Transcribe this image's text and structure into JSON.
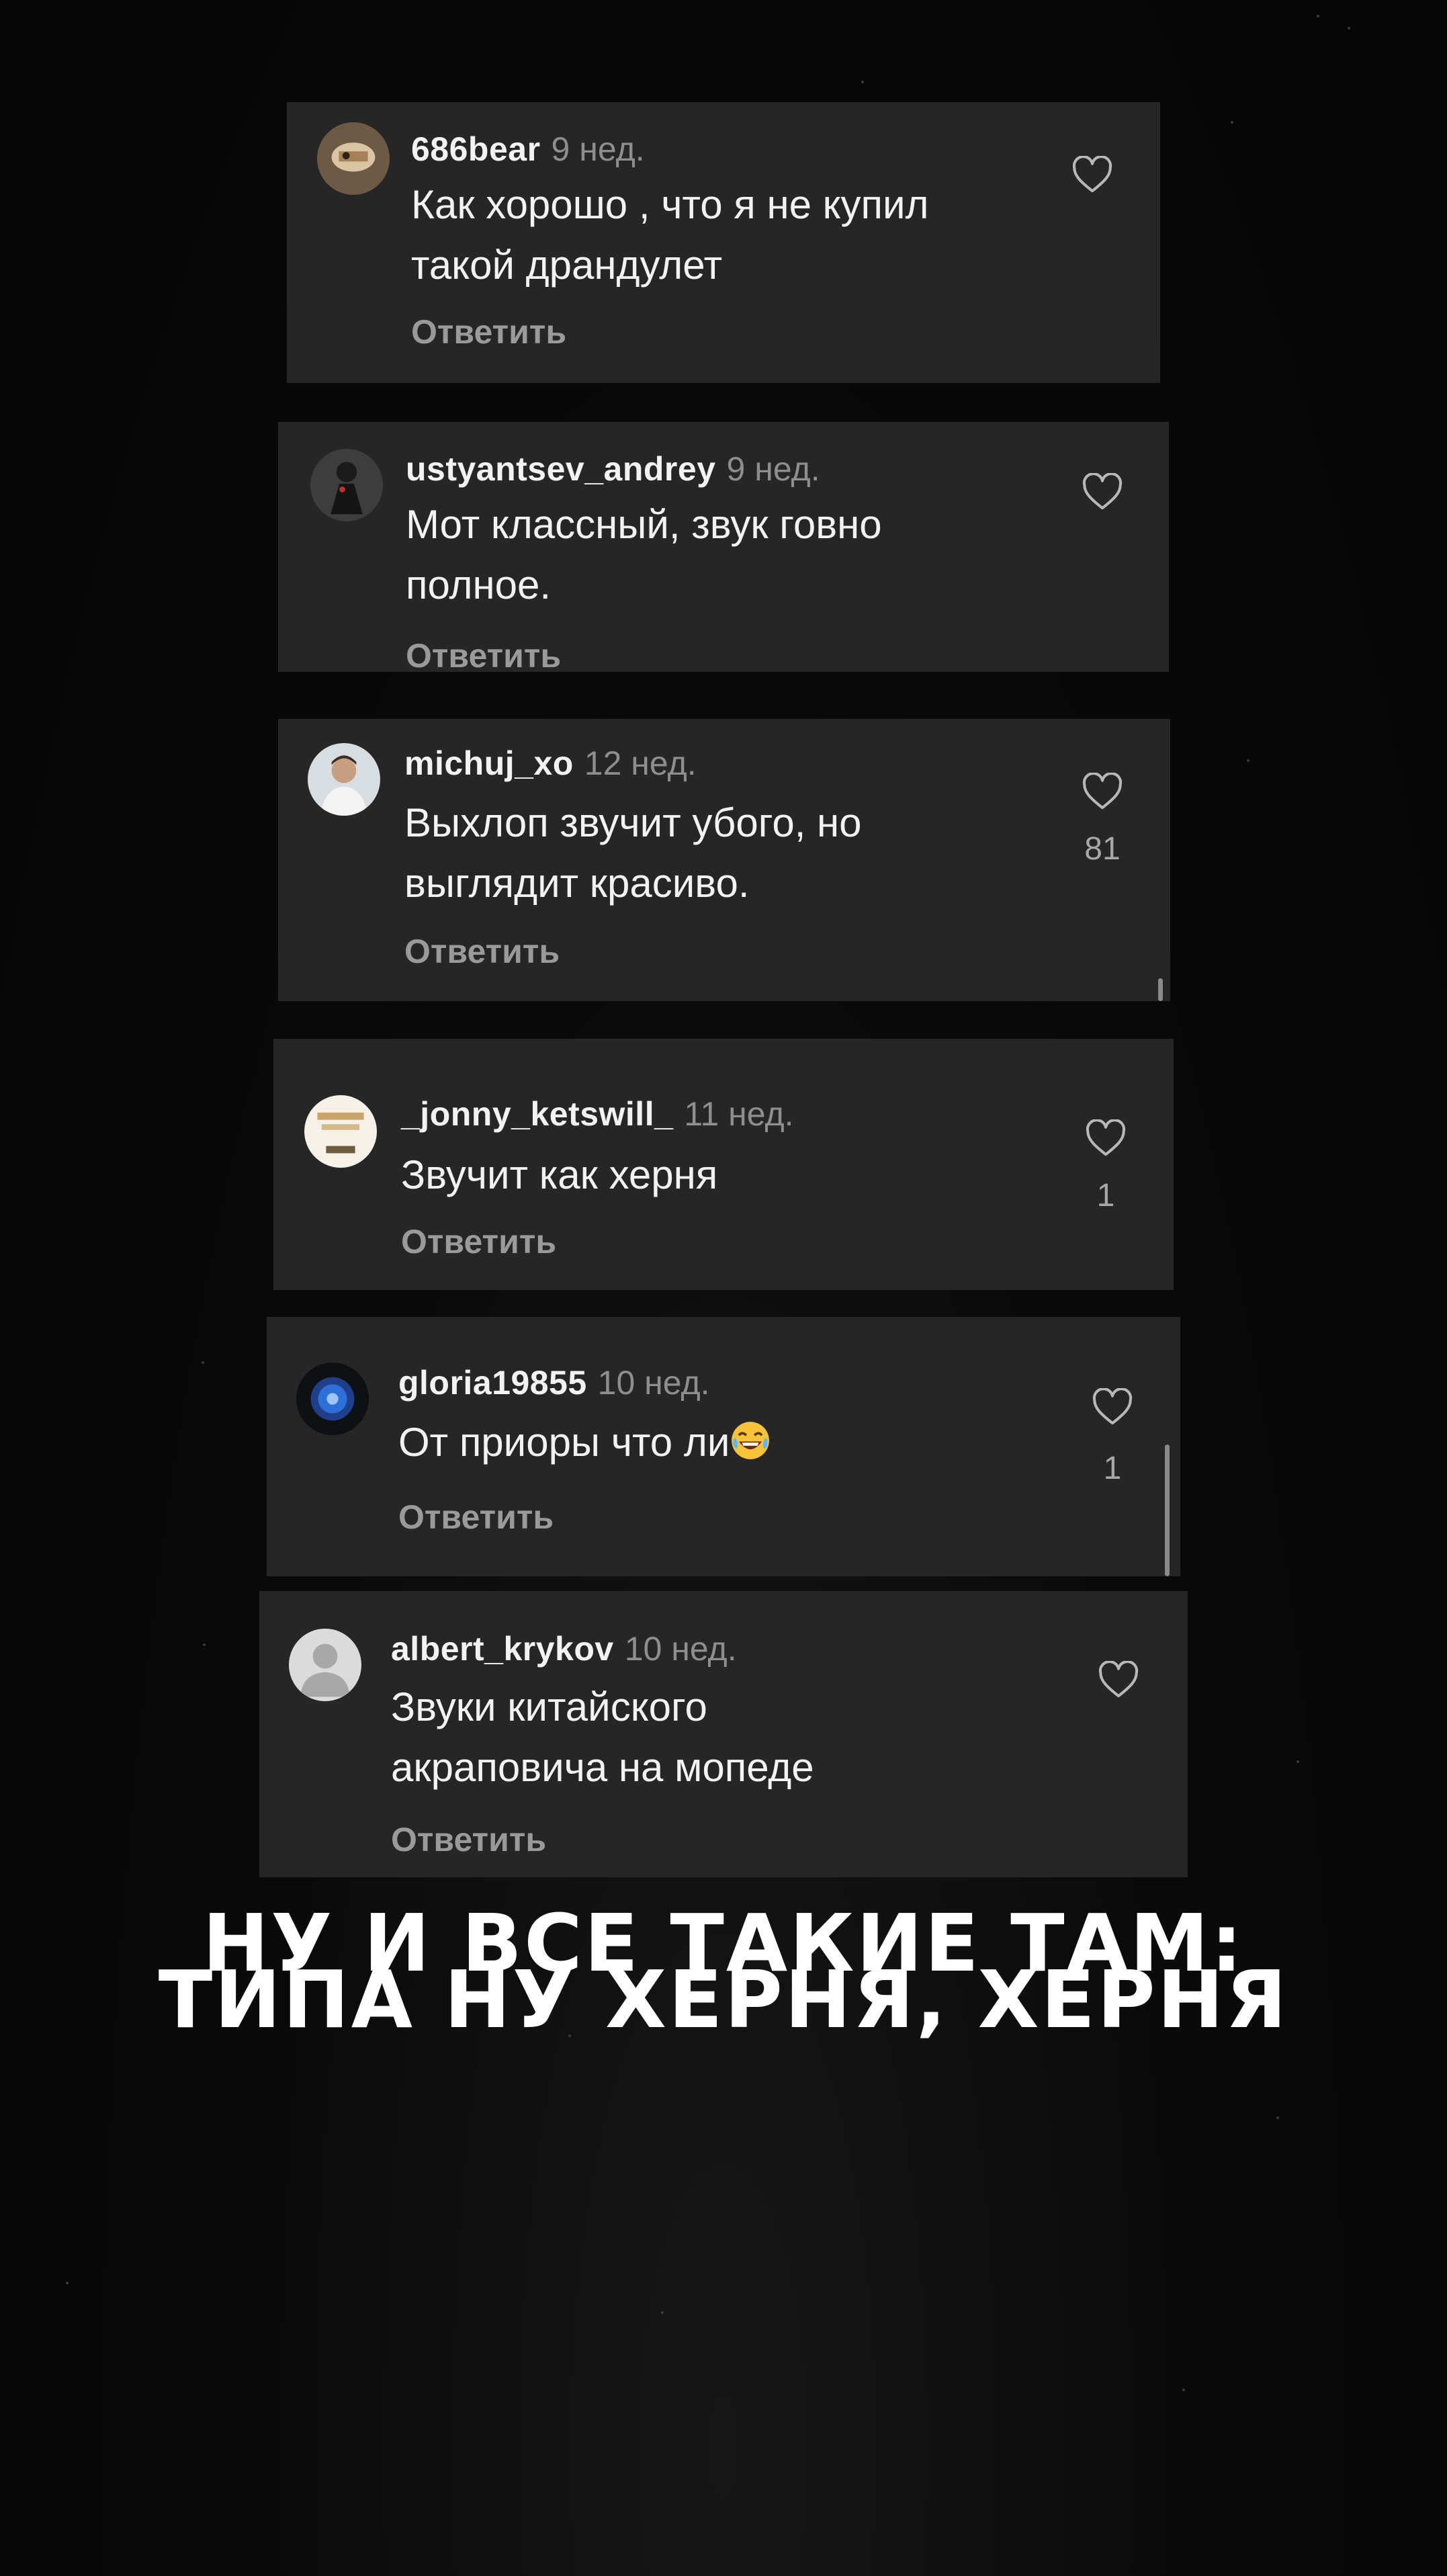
{
  "comments": [
    {
      "username": "686bear",
      "ago": "9 нед.",
      "lines": [
        "Как хорошо , что я не купил",
        "такой драндулет"
      ],
      "reply": "Ответить",
      "likes": "",
      "avatar_icon": "photo-avatar-icon"
    },
    {
      "username": "ustyantsev_andrey",
      "ago": "9 нед.",
      "lines": [
        "Мот классный, звук говно",
        "полное."
      ],
      "reply": "Ответить",
      "likes": "",
      "avatar_icon": "photo-avatar-icon"
    },
    {
      "username": "michuj_xo",
      "ago": "12 нед.",
      "lines": [
        "Выхлоп звучит убого, но",
        "выглядит красиво."
      ],
      "reply": "Ответить",
      "likes": "81",
      "avatar_icon": "photo-avatar-icon"
    },
    {
      "username": "_jonny_ketswill_",
      "ago": "11 нед.",
      "lines": [
        "Звучит как херня"
      ],
      "reply": "Ответить",
      "likes": "1",
      "avatar_icon": "photo-avatar-icon"
    },
    {
      "username": "gloria19855",
      "ago": "10 нед.",
      "lines": [
        "От приоры что ли"
      ],
      "emoji": "laughing-emoji",
      "reply": "Ответить",
      "likes": "1",
      "avatar_icon": "photo-avatar-icon"
    },
    {
      "username": "albert_krykov",
      "ago": "10 нед.",
      "lines": [
        "Звуки китайского",
        "акраповича на мопеде"
      ],
      "reply": "Ответить",
      "likes": "",
      "avatar_icon": "default-user-avatar-icon"
    }
  ],
  "caption": {
    "line1": "НУ И ВСЕ ТАКИЕ ТАМ:",
    "line2": "ТИПА НУ ХЕРНЯ, ХЕРНЯ"
  },
  "colors": {
    "card_background": "#262626",
    "page_background": "#0a0a0a",
    "text_primary": "#f2f2f2",
    "text_secondary": "#8e8e8e"
  },
  "icons": {
    "like": "heart-outline-icon"
  }
}
